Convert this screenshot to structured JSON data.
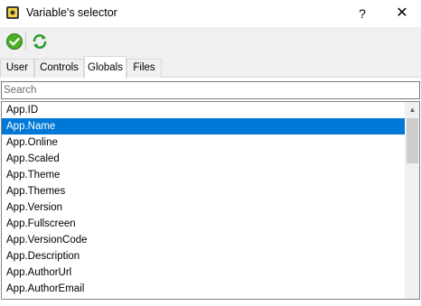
{
  "window": {
    "title": "Variable's selector",
    "help_label": "?",
    "close_label": "✕"
  },
  "toolbar": {
    "ok_icon": "check-icon",
    "refresh_icon": "refresh-icon"
  },
  "tabs": [
    {
      "label": "User"
    },
    {
      "label": "Controls"
    },
    {
      "label": "Globals",
      "active": true
    },
    {
      "label": "Files"
    }
  ],
  "search": {
    "placeholder": "Search",
    "value": ""
  },
  "list": {
    "selected": "App.Name",
    "items": [
      "App.ID",
      "App.Name",
      "App.Online",
      "App.Scaled",
      "App.Theme",
      "App.Themes",
      "App.Version",
      "App.Fullscreen",
      "App.VersionCode",
      "App.Description",
      "App.AuthorUrl",
      "App.AuthorEmail"
    ]
  },
  "colors": {
    "selection": "#0078d7",
    "ok_green": "#3a9a1e",
    "refresh_green": "#2e9a2e"
  }
}
